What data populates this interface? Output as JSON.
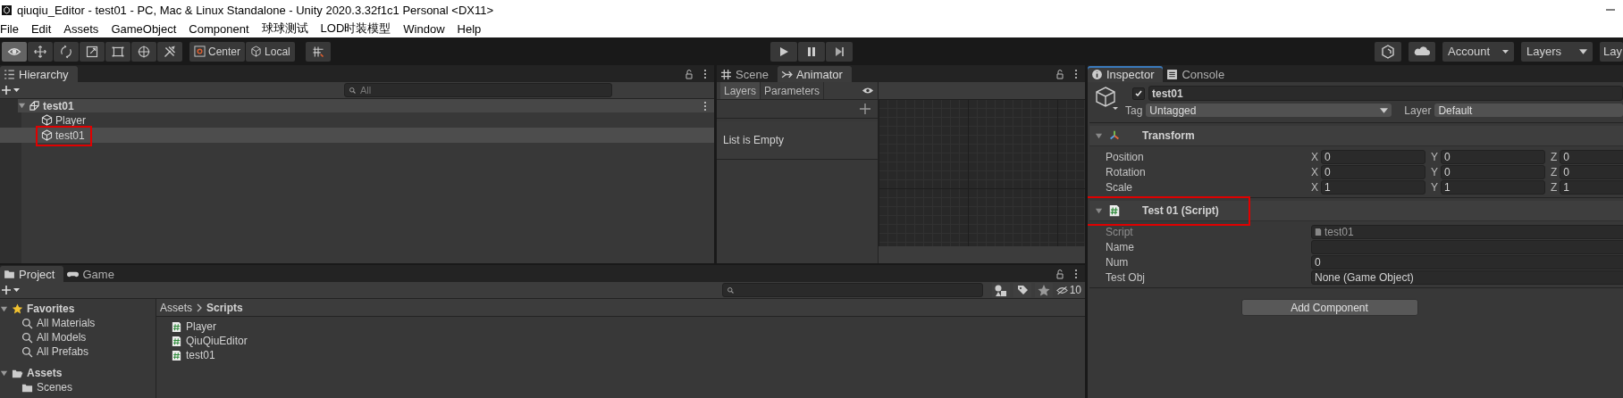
{
  "window": {
    "title": "qiuqiu_Editor - test01 - PC, Mac & Linux Standalone - Unity 2020.3.32f1c1 Personal <DX11>"
  },
  "menu": [
    "File",
    "Edit",
    "Assets",
    "GameObject",
    "Component",
    "球球测试",
    "LOD时装模型",
    "Window",
    "Help"
  ],
  "toolbar": {
    "tools": [
      {
        "kind": "view",
        "selected": true
      },
      {
        "kind": "move",
        "selected": false
      },
      {
        "kind": "rotate",
        "selected": false
      },
      {
        "kind": "scale",
        "selected": false
      },
      {
        "kind": "rect",
        "selected": false
      },
      {
        "kind": "transform",
        "selected": false
      },
      {
        "kind": "custom",
        "selected": false
      }
    ],
    "pivot": "Center",
    "space": "Local",
    "account": "Account",
    "layers": "Layers",
    "layout": "Lay"
  },
  "hierarchy": {
    "tab": "Hierarchy",
    "search_placeholder": "All",
    "scene": {
      "name": "test01",
      "expanded": true,
      "children": [
        {
          "name": "Player",
          "selected": false,
          "highlighted": false
        },
        {
          "name": "test01",
          "selected": true,
          "highlighted": true
        }
      ]
    }
  },
  "animator": {
    "tabs": [
      {
        "label": "Scene",
        "selected": false
      },
      {
        "label": "Animator",
        "selected": true
      }
    ],
    "subtabs": [
      {
        "label": "Layers",
        "selected": true
      },
      {
        "label": "Parameters",
        "selected": false
      }
    ],
    "empty_text": "List is Empty"
  },
  "inspector": {
    "tabs": [
      {
        "label": "Inspector",
        "selected": true
      },
      {
        "label": "Console",
        "selected": false
      }
    ],
    "object": {
      "active": true,
      "name": "test01",
      "tag_label": "Tag",
      "tag": "Untagged",
      "layer_label": "Layer",
      "layer": "Default"
    },
    "components": [
      {
        "kind": "transform",
        "title": "Transform",
        "expanded": true,
        "highlighted": false,
        "rows": [
          {
            "label": "Position",
            "values": [
              {
                "axis": "X",
                "value": "0"
              },
              {
                "axis": "Y",
                "value": "0"
              },
              {
                "axis": "Z",
                "value": "0"
              }
            ]
          },
          {
            "label": "Rotation",
            "values": [
              {
                "axis": "X",
                "value": "0"
              },
              {
                "axis": "Y",
                "value": "0"
              },
              {
                "axis": "Z",
                "value": "0"
              }
            ]
          },
          {
            "label": "Scale",
            "values": [
              {
                "axis": "X",
                "value": "1"
              },
              {
                "axis": "Y",
                "value": "1"
              },
              {
                "axis": "Z",
                "value": "1"
              }
            ]
          }
        ]
      },
      {
        "kind": "script",
        "title": "Test 01 (Script)",
        "expanded": true,
        "highlighted": true,
        "fields": [
          {
            "label": "Script",
            "value": "test01",
            "disabled": true
          },
          {
            "label": "Name",
            "disabled": false
          },
          {
            "label": "Num",
            "value": "0",
            "disabled": false
          },
          {
            "label": "Test Obj",
            "value": "None (Game Object)",
            "disabled": false
          }
        ]
      }
    ],
    "add_component": "Add Component"
  },
  "project": {
    "tabs": [
      {
        "label": "Project",
        "selected": true
      },
      {
        "label": "Game",
        "selected": false
      }
    ],
    "hidden_count": "10",
    "tree": [
      {
        "label": "Favorites",
        "kind": "favorites",
        "expanded": true,
        "children": [
          {
            "label": "All Materials"
          },
          {
            "label": "All Models"
          },
          {
            "label": "All Prefabs"
          }
        ]
      },
      {
        "label": "Assets",
        "kind": "folder",
        "expanded": true,
        "children": [
          {
            "label": "Scenes"
          }
        ]
      }
    ],
    "breadcrumb": [
      "Assets",
      "Scripts"
    ],
    "files": [
      "Player",
      "QiuQiuEditor",
      "test01"
    ]
  }
}
